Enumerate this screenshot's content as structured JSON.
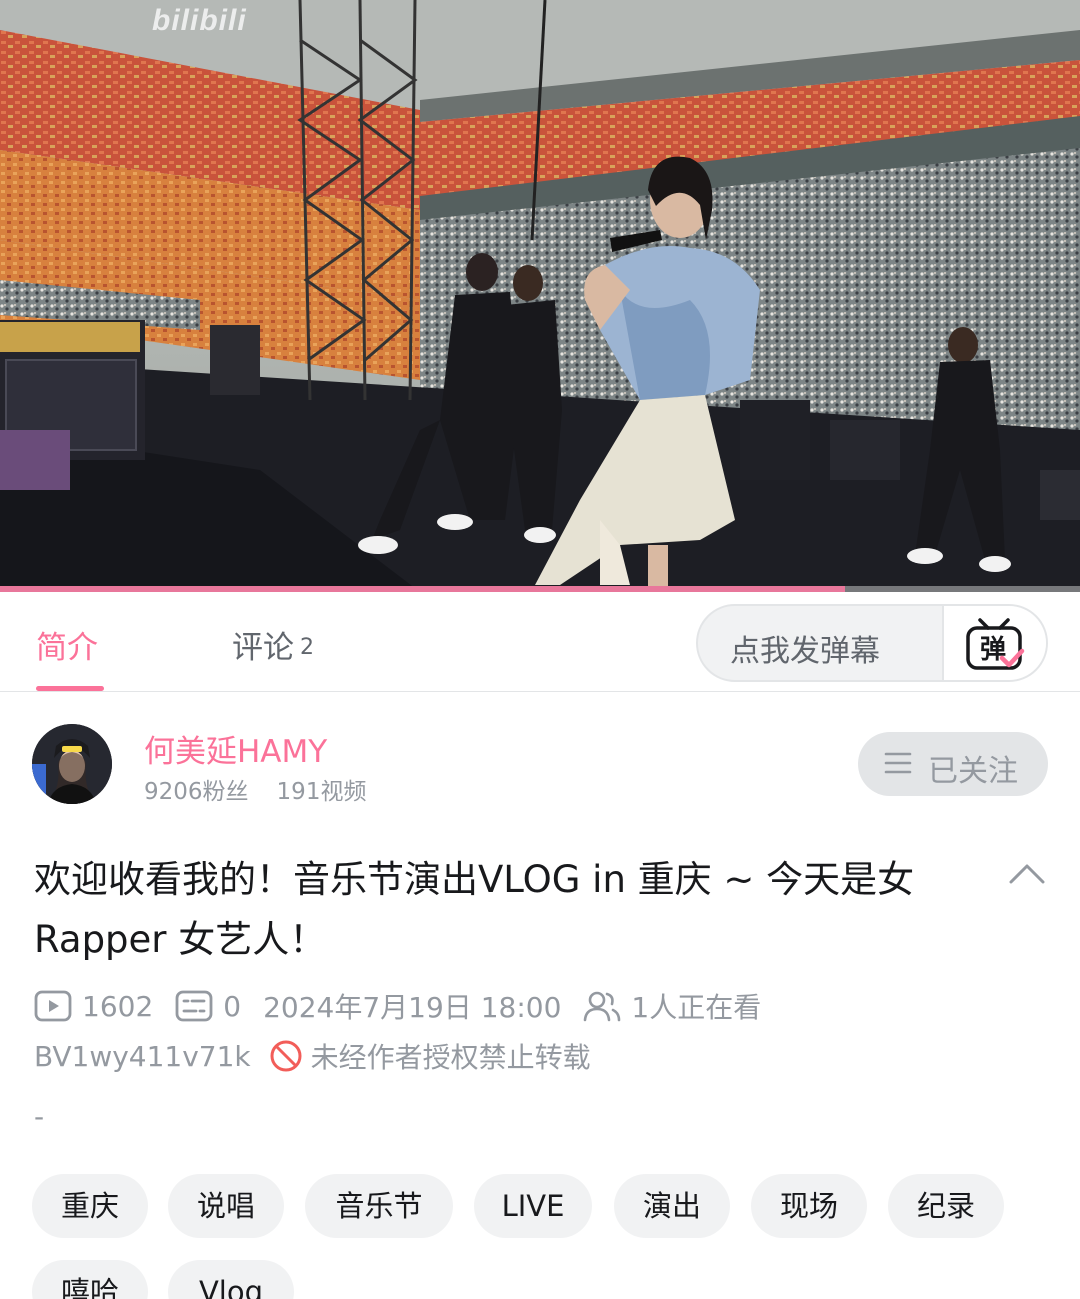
{
  "video": {
    "watermark": "bilibili",
    "progress_fraction": 0.782
  },
  "tabs": {
    "intro_label": "简介",
    "comments_label": "评论",
    "comments_count": "2",
    "danmaku_placeholder": "点我发弹幕",
    "danmaku_button_glyph": "弹"
  },
  "uploader": {
    "name": "何美延HAMY",
    "fans": "9206粉丝",
    "videos": "191视频",
    "follow_label": "已关注"
  },
  "video_info": {
    "title": "欢迎收看我的！音乐节演出VLOG in 重庆 ~ 今天是女Rapper 女艺人！",
    "views": "1602",
    "danmaku_count": "0",
    "publish_time": "2024年7月19日 18:00",
    "watching": "1人正在看",
    "bvid": "BV1wy411v71k",
    "copyright_notice": "未经作者授权禁止转载",
    "description": "-"
  },
  "tags": [
    "重庆",
    "说唱",
    "音乐节",
    "LIVE",
    "演出",
    "现场",
    "纪录",
    "嘻哈",
    "Vlog"
  ],
  "colors": {
    "accent_pink": "#fb7299",
    "progress_pink": "#e8779b",
    "secondary_text": "#9499a0",
    "tag_bg": "#f1f2f3",
    "forbid_red": "#f25d59"
  },
  "icons": [
    "play-count-icon",
    "danmaku-count-icon",
    "watching-icon",
    "forbid-icon",
    "menu-icon",
    "chevron-up-icon",
    "danmaku-send-icon"
  ]
}
